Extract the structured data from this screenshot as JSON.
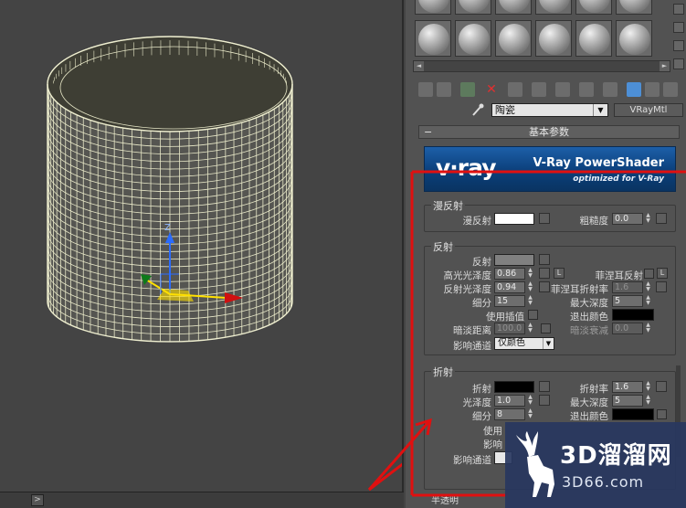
{
  "material_name": "陶瓷",
  "material_type": "VRayMtl",
  "rollout_title": "基本参数",
  "banner": {
    "logo": "v·ray",
    "title": "V-Ray PowerShader",
    "subtitle": "optimized for V-Ray"
  },
  "diffuse": {
    "group_title": "漫反射",
    "diffuse_label": "漫反射",
    "diffuse_color": "#ffffff",
    "roughness_label": "粗糙度",
    "roughness_value": "0.0"
  },
  "reflection": {
    "group_title": "反射",
    "reflect_label": "反射",
    "reflect_color": "#808080",
    "hilight_gloss_label": "高光光泽度",
    "hilight_gloss_value": "0.86",
    "l_button": "L",
    "fresnel_label": "菲涅耳反射",
    "fresnel_l": "L",
    "refl_gloss_label": "反射光泽度",
    "refl_gloss_value": "0.94",
    "fresnel_ior_label": "菲涅耳折射率",
    "fresnel_ior_value": "1.6",
    "subdivs_label": "细分",
    "subdivs_value": "15",
    "max_depth_label": "最大深度",
    "max_depth_value": "5",
    "use_interp_label": "使用插值",
    "exit_color_label": "退出颜色",
    "exit_color": "#000000",
    "dim_distance_label": "暗淡距离",
    "dim_distance_value": "100.0",
    "dim_falloff_label": "暗淡衰减",
    "dim_falloff_value": "0.0",
    "affect_channels_label": "影响通道",
    "affect_channels_value": "仅颜色"
  },
  "refraction": {
    "group_title": "折射",
    "refract_label": "折射",
    "refract_color": "#000000",
    "ior_label": "折射率",
    "ior_value": "1.6",
    "gloss_label": "光泽度",
    "gloss_value": "1.0",
    "max_depth_label": "最大深度",
    "max_depth_value": "5",
    "subdivs_label": "细分",
    "subdivs_value": "8",
    "exit_color_label": "退出颜色",
    "exit_color": "#000000",
    "use_label": "使用",
    "affect_label": "影响",
    "affect_channels_label": "影响通道"
  },
  "translucency_label": "半透明",
  "timeline_arrow": ">",
  "scroll_left": "◄",
  "scroll_right": "►",
  "watermark": {
    "line1": "3D溜溜网",
    "line2": "3D66.com"
  },
  "colors": {
    "annotation_red": "#e01010",
    "wire": "#e8e8c8",
    "panel": "#525252",
    "viewport": "#444444"
  }
}
